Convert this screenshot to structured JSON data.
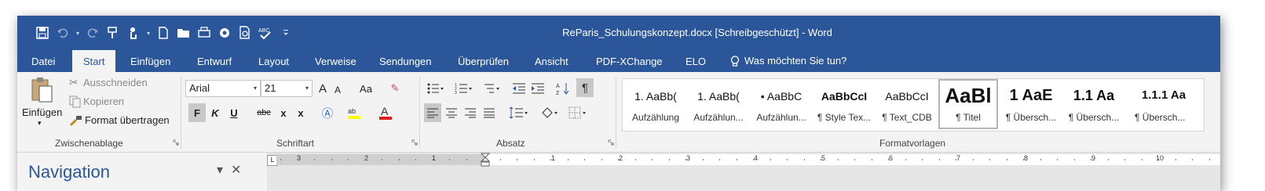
{
  "window": {
    "title": "ReParis_Schulungskonzept.docx [Schreibgeschützt] - Word"
  },
  "qat": {
    "icons": [
      "save-icon",
      "undo-icon",
      "redo-icon",
      "format-painter-icon",
      "touch-mode-icon",
      "new-document-icon",
      "open-folder-icon",
      "print-preview-icon",
      "macro-icon",
      "page-preview-icon",
      "spelling-icon",
      "customize-qat-icon"
    ]
  },
  "tabs": [
    {
      "label": "Datei"
    },
    {
      "label": "Start"
    },
    {
      "label": "Einfügen"
    },
    {
      "label": "Entwurf"
    },
    {
      "label": "Layout"
    },
    {
      "label": "Verweise"
    },
    {
      "label": "Sendungen"
    },
    {
      "label": "Überprüfen"
    },
    {
      "label": "Ansicht"
    },
    {
      "label": "PDF-XChange"
    },
    {
      "label": "ELO"
    }
  ],
  "tell_me": "Was möchten Sie tun?",
  "clipboard": {
    "paste": "Einfügen",
    "cut": "Ausschneiden",
    "copy": "Kopieren",
    "format_painter": "Format übertragen",
    "group_label": "Zwischenablage"
  },
  "font": {
    "family": "Arial",
    "size": "21",
    "group_label": "Schriftart",
    "grow": "A",
    "shrink": "A",
    "change_case": "Aa",
    "bold": "F",
    "italic": "K",
    "underline": "U",
    "strikethrough": "abc",
    "subscript": "x",
    "superscript": "x",
    "highlight_color": "#ffff00",
    "font_color": "#e02020"
  },
  "paragraph": {
    "group_label": "Absatz",
    "show_marks": "¶"
  },
  "styles": {
    "group_label": "Formatvorlagen",
    "items": [
      {
        "preview": "1. AaBb(",
        "name": "Aufzählung"
      },
      {
        "preview": "1. AaBb(",
        "name": "Aufzählun..."
      },
      {
        "preview": "• AaBbC",
        "name": "Aufzählun..."
      },
      {
        "preview": "AaBbCcI",
        "name": "¶ Style Tex..."
      },
      {
        "preview": "AaBbCcI",
        "name": "¶ Text_CDB"
      },
      {
        "preview": "AaBl",
        "name": "¶ Titel"
      },
      {
        "preview": "1 AaE",
        "name": "¶ Übersch..."
      },
      {
        "preview": "1.1 Aa",
        "name": "¶ Übersch..."
      },
      {
        "preview": "1.1.1 Aa",
        "name": "¶ Übersch..."
      }
    ]
  },
  "navigation": {
    "title": "Navigation",
    "dropdown": "▾",
    "close": "✕"
  },
  "ruler": {
    "tab_selector": "L",
    "left_numbers": [
      "3",
      "2",
      "1"
    ],
    "right_numbers": [
      "1",
      "2",
      "3",
      "4",
      "5",
      "6",
      "7",
      "8",
      "9",
      "10"
    ]
  },
  "colors": {
    "accent": "#2b579a",
    "ribbon_bg": "#f3f3f3"
  }
}
